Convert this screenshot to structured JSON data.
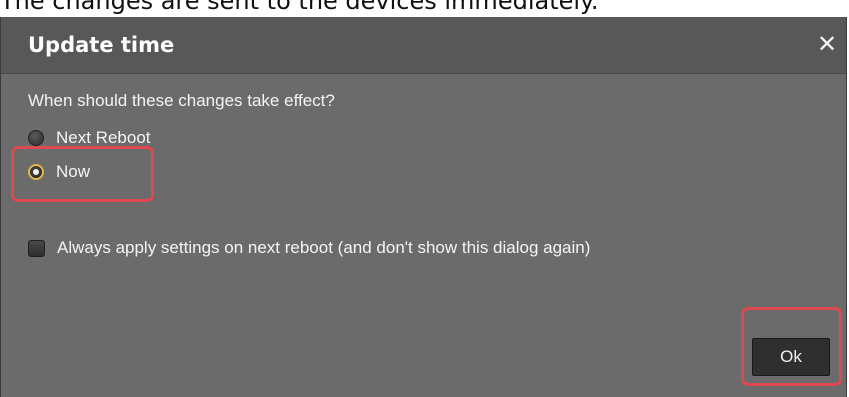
{
  "document": {
    "intro_text": "The changes are sent to the devices immediately."
  },
  "dialog": {
    "title": "Update time",
    "close_icon": "close-icon",
    "question": "When should these changes take effect?",
    "options": [
      {
        "label": "Next Reboot",
        "selected": false
      },
      {
        "label": "Now",
        "selected": true
      }
    ],
    "checkbox": {
      "label": "Always apply settings on next reboot (and don't show this dialog again)",
      "checked": false
    },
    "ok_label": "Ok"
  },
  "colors": {
    "dialog_background": "#6b6b6b",
    "titlebar_background": "#585858",
    "highlight": "#e0474e",
    "radio_selected_ring": "#e1b64a"
  }
}
